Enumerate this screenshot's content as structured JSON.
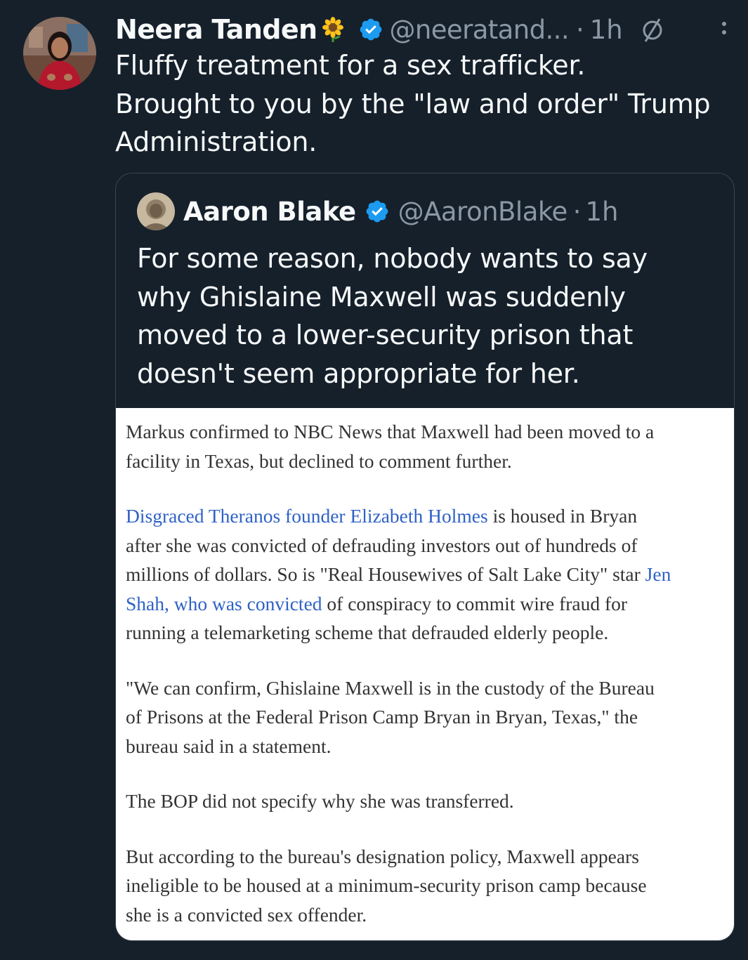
{
  "post": {
    "author_name": "Neera Tanden",
    "author_emoji": "sunflower",
    "handle": "@neeratand...",
    "separator": "·",
    "time": "1h",
    "text_lines": [
      "Fluffy treatment for a sex trafficker.",
      "Brought to you by the \"law and order\" Trump",
      "Administration."
    ]
  },
  "quote": {
    "author_name": "Aaron Blake",
    "handle": "@AaronBlake",
    "separator": "·",
    "time": "1h",
    "text_lines": [
      "For some reason, nobody wants to say",
      "why Ghislaine Maxwell was suddenly",
      "moved to a lower-security prison that",
      "doesn't seem appropriate for her."
    ]
  },
  "article": {
    "p1": [
      "Markus confirmed to NBC News that Maxwell had been moved to a",
      "facility in Texas, but declined to comment further."
    ],
    "p2": {
      "l1_link": "Disgraced Theranos founder Elizabeth Holmes",
      "l1_rest": " is housed in Bryan",
      "l2": "after she was convicted of defrauding investors out of hundreds of",
      "l3_text": "millions of dollars. So is \"Real Housewives of Salt Lake City\" star ",
      "l3_link": "Jen",
      "l4_link": "Shah, who was convicted",
      "l4_rest": " of conspiracy to commit wire fraud for",
      "l5": "running a telemarketing scheme that defrauded elderly people."
    },
    "p3": [
      "\"We can confirm, Ghislaine Maxwell is in the custody of the Bureau",
      "of Prisons at the Federal Prison Camp Bryan in Bryan, Texas,\" the",
      "bureau said in a statement."
    ],
    "p4": [
      "The BOP did not specify why she was transferred."
    ],
    "p5": [
      "But according to the bureau's designation policy, Maxwell appears",
      "ineligible to be housed at a minimum-security prison camp because",
      "she is a convicted sex offender."
    ]
  },
  "colors": {
    "background": "#15202b",
    "text": "#f7f9f9",
    "muted": "#8b98a5",
    "verified": "#1d9bf0",
    "link": "#2f62c5",
    "border": "#38444d"
  },
  "icons": {
    "verified": "verified-badge-icon",
    "nope": "circle-slash-icon",
    "more": "more-vertical-icon"
  }
}
